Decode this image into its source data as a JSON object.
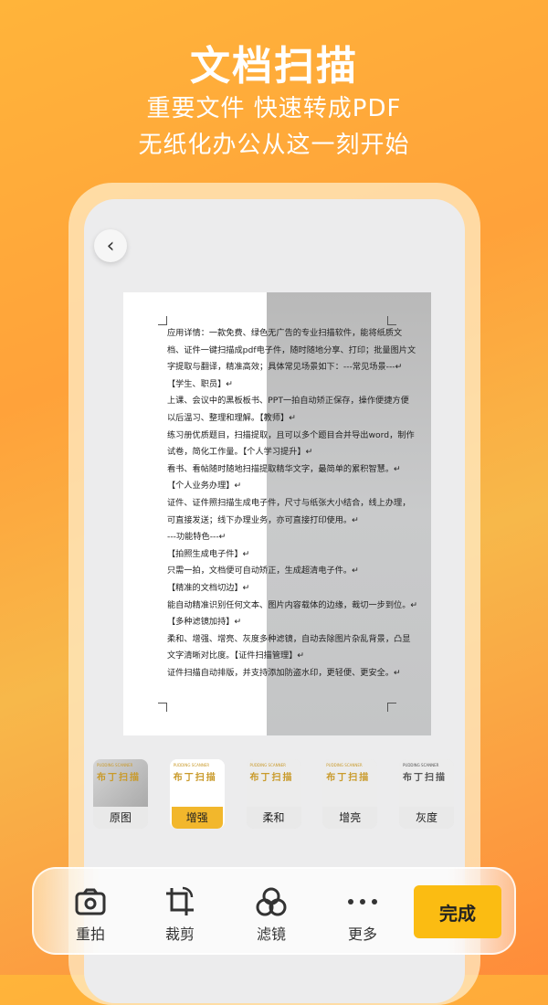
{
  "hero": {
    "title": "文档扫描",
    "subtitle1": "重要文件  快速转成PDF",
    "subtitle2": "无纸化办公从这一刻开始"
  },
  "document_lines": [
    "应用详情：一款免费、绿色无广告的专业扫描软件，能将纸质文",
    "档、证件一键扫描成pdf电子件，随时随地分享、打印；批量图片文",
    "字提取与翻译，精准高效；具体常见场景如下：---常见场景---↵",
    "【学生、职员】↵",
    "上课、会议中的黑板板书、PPT一拍自动矫正保存，操作便捷方便",
    "以后温习、整理和理解。【教师】↵",
    "练习册优质题目，扫描提取，且可以多个题目合并导出word，制作",
    "试卷，简化工作量。【个人学习提升】↵",
    "看书、看帖随时随地扫描提取精华文字，最简单的累积智慧。↵",
    "【个人业务办理】↵",
    "证件、证件照扫描生成电子件，尺寸与纸张大小结合，线上办理，",
    "可直接发送；线下办理业务，亦可直接打印使用。↵",
    "---功能特色---↵",
    "【拍照生成电子件】↵",
    "只需一拍，文档便可自动矫正，生成超清电子件。↵",
    "【精准的文档切边】↵",
    "能自动精准识别任何文本、图片内容载体的边缘，裁切一步到位。↵",
    "【多种滤镜加持】↵",
    "柔和、增强、增亮、灰度多种滤镜，自动去除图片杂乱背景，凸显",
    "文字清晰对比度。【证件扫描管理】↵",
    "证件扫描自动排版，并支持添加防盗水印，更轻便、更安全。↵"
  ],
  "filters": [
    {
      "label": "原图",
      "thumb_brand": "PUDDING SCANNER",
      "thumb_title": "布丁扫描",
      "active": false
    },
    {
      "label": "增强",
      "thumb_brand": "PUDDING SCANNER",
      "thumb_title": "布丁扫描",
      "active": true
    },
    {
      "label": "柔和",
      "thumb_brand": "PUDDING SCANNER",
      "thumb_title": "布丁扫描",
      "active": false
    },
    {
      "label": "增亮",
      "thumb_brand": "PUDDING SCANNER",
      "thumb_title": "布丁扫描",
      "active": false
    },
    {
      "label": "灰度",
      "thumb_brand": "PUDDING SCANNER",
      "thumb_title": "布丁扫描",
      "active": false
    }
  ],
  "toolbar": {
    "retake": "重拍",
    "crop": "裁剪",
    "filter": "滤镜",
    "more": "更多",
    "done": "完成"
  },
  "colors": {
    "accent": "#fbbc12",
    "active_filter": "#f2b72c"
  }
}
